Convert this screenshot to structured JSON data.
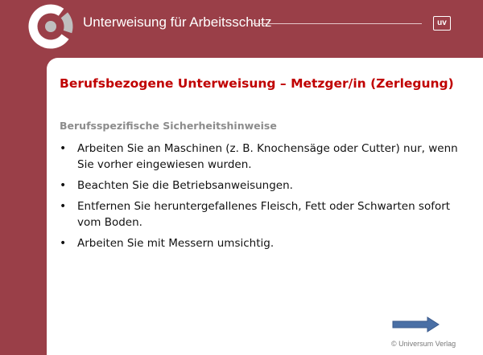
{
  "header": {
    "title": "Unterweisung für Arbeitsschutz",
    "logo_icon": "ring-logo-icon",
    "badge_text": "uv",
    "background_color": "#9a3f48"
  },
  "slide": {
    "title": "Berufsbezogene Unterweisung – Metzger/in (Zerlegung)",
    "title_color": "#c00000",
    "section_heading": "Berufsspezifische Sicherheitshinweise",
    "bullet_symbol": "•",
    "bullets": [
      "Arbeiten Sie an Maschinen (z. B. Knochensäge oder Cutter) nur, wenn Sie vorher eingewiesen wurden.",
      "Beachten Sie die Betriebsanweisungen.",
      "Entfernen Sie heruntergefallenes Fleisch, Fett oder Schwarten sofort vom Boden.",
      "Arbeiten Sie mit Messern umsichtig."
    ]
  },
  "footer": {
    "next_icon": "arrow-right-icon",
    "copyright": "© Universum Verlag"
  }
}
